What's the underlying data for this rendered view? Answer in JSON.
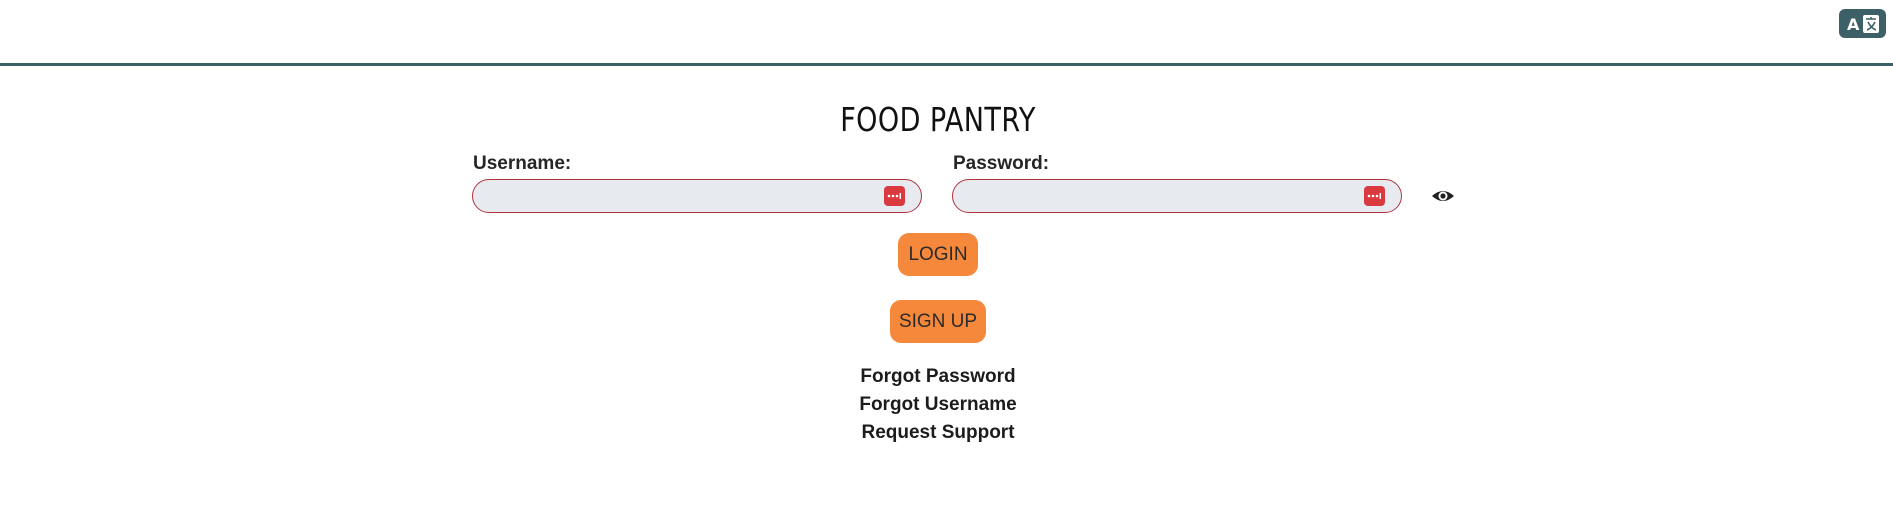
{
  "header": {
    "translate_icon": "translate-icon",
    "accent_color": "#3d6068"
  },
  "page": {
    "title": "FOOD PANTRY"
  },
  "form": {
    "username_label": "Username:",
    "username_value": "",
    "password_label": "Password:",
    "password_value": "",
    "password_manager_icon": "password-manager-icon",
    "show_password_icon": "eye-icon",
    "field_border_color": "#b0323c"
  },
  "buttons": {
    "login_label": "LOGIN",
    "signup_label": "SIGN UP",
    "color": "#f5883a"
  },
  "links": {
    "forgot_password": "Forgot Password",
    "forgot_username": "Forgot Username",
    "request_support": "Request Support"
  }
}
